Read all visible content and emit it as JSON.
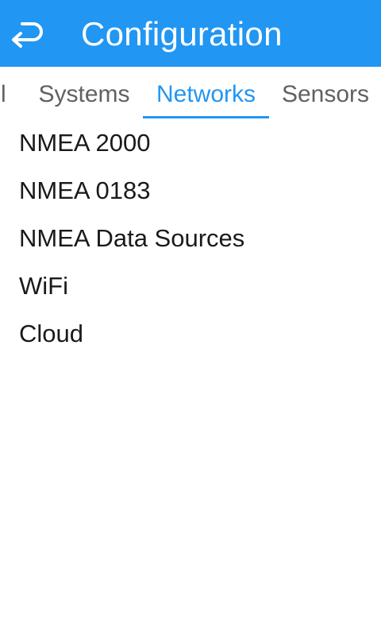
{
  "app_bar": {
    "title": "Configuration",
    "background_color": "#2196f3",
    "back_icon": "back-arrow-icon"
  },
  "tabs": [
    {
      "label": "el",
      "active": false
    },
    {
      "label": "Systems",
      "active": false
    },
    {
      "label": "Networks",
      "active": true
    },
    {
      "label": "Sensors",
      "active": false
    }
  ],
  "accent_color": "#2196f3",
  "list": {
    "items": [
      {
        "label": "NMEA 2000"
      },
      {
        "label": "NMEA 0183"
      },
      {
        "label": "NMEA Data Sources"
      },
      {
        "label": "WiFi"
      },
      {
        "label": "Cloud"
      }
    ]
  }
}
